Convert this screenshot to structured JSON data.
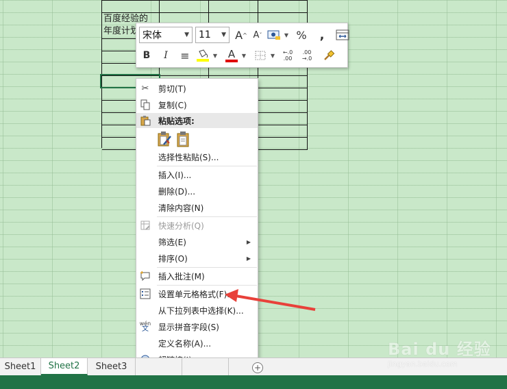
{
  "sheet": {
    "cells": {
      "a1_line1": "百度经验的",
      "a1_line2": "年度计划"
    }
  },
  "mini_toolbar": {
    "font_name": "宋体",
    "font_size": "11",
    "grow_font": "A",
    "shrink_font": "A",
    "percent": "%",
    "comma": ",",
    "bold": "B",
    "italic": "I",
    "align": "≡",
    "font_color_glyph": "A",
    "inc_decimal_top": "←.0",
    "inc_decimal_bottom": ".00",
    "dec_decimal_top": ".00",
    "dec_decimal_bottom": "→.0",
    "colors": {
      "highlight": "#ffff00",
      "font": "#e00000"
    }
  },
  "context_menu": {
    "cut": "剪切(T)",
    "copy": "复制(C)",
    "paste_options": "粘贴选项:",
    "paste_special": "选择性粘贴(S)...",
    "insert": "插入(I)...",
    "delete": "删除(D)...",
    "clear_contents": "清除内容(N)",
    "quick_analysis": "快速分析(Q)",
    "filter": "筛选(E)",
    "sort": "排序(O)",
    "insert_comment": "插入批注(M)",
    "format_cells": "设置单元格格式(F)...",
    "pick_from_list": "从下拉列表中选择(K)...",
    "phonetic": "显示拼音字段(S)",
    "define_name": "定义名称(A)...",
    "hyperlink": "超链接(I)...",
    "phonetic_icon_top": "wén",
    "phonetic_icon_bottom": "文"
  },
  "tabs": {
    "sheet1": "Sheet1",
    "sheet2": "Sheet2",
    "sheet3": "Sheet3",
    "add": "+"
  },
  "watermark": {
    "logo": "Bai du 经验",
    "url": "jingyan.baidu.com"
  },
  "colors": {
    "excel_green": "#217346",
    "annotation_arrow": "#e8413a"
  }
}
